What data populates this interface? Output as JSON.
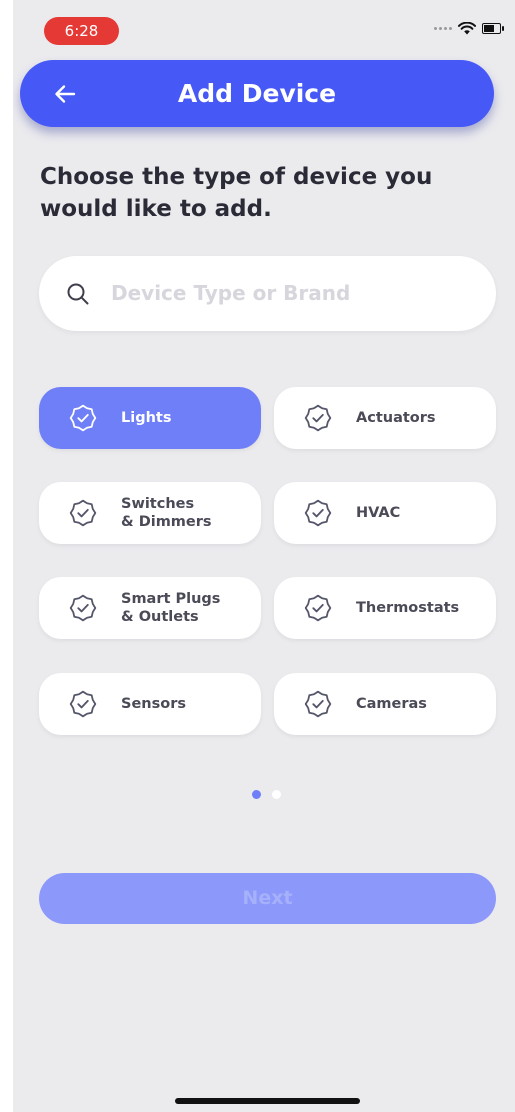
{
  "status_bar": {
    "time": "6:28",
    "time_pill_color": "#e53935"
  },
  "app_bar": {
    "title": "Add Device",
    "color": "#4658f6"
  },
  "headline": "Choose the type of device you would like to add.",
  "search": {
    "placeholder": "Device Type or Brand"
  },
  "device_types": [
    {
      "label": "Lights",
      "selected": true,
      "icon": "badge-check-icon"
    },
    {
      "label": "Actuators",
      "selected": false,
      "icon": "badge-check-icon"
    },
    {
      "label": "Switches\n& Dimmers",
      "selected": false,
      "icon": "badge-check-icon"
    },
    {
      "label": "HVAC",
      "selected": false,
      "icon": "badge-check-icon"
    },
    {
      "label": "Smart Plugs\n& Outlets",
      "selected": false,
      "icon": "badge-check-icon"
    },
    {
      "label": "Thermostats",
      "selected": false,
      "icon": "badge-check-icon"
    },
    {
      "label": "Sensors",
      "selected": false,
      "icon": "badge-check-icon"
    },
    {
      "label": "Cameras",
      "selected": false,
      "icon": "badge-check-icon"
    }
  ],
  "pagination": {
    "current_page": 1,
    "total_pages": 2
  },
  "next_button": {
    "label": "Next",
    "enabled": false
  },
  "colors": {
    "accent": "#6e7ff7",
    "background": "#ebebee"
  }
}
